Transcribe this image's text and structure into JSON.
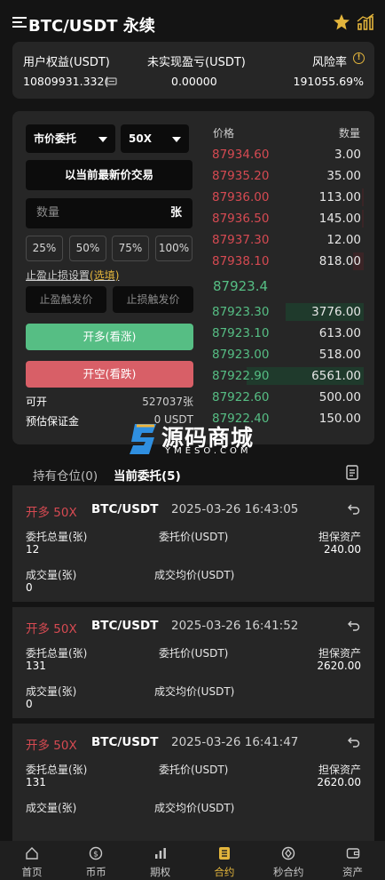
{
  "header": {
    "title": "BTC/USDT 永续"
  },
  "summary": {
    "equity_label": "用户权益(USDT)",
    "equity_value": "10809931.332(",
    "pnl_label": "未实现盈亏(USDT)",
    "pnl_value": "0.00000",
    "risk_label": "风险率",
    "risk_value": "191055.69%"
  },
  "trade": {
    "order_type": "市价委托",
    "leverage": "50X",
    "latest_price_button": "以当前最新价交易",
    "quantity_placeholder": "数量",
    "quantity_unit": "张",
    "percents": [
      "25%",
      "50%",
      "75%",
      "100%"
    ],
    "tpsl_label": "止盈止损设置",
    "tpsl_optional": "(选填)",
    "tp_placeholder": "止盈触发价",
    "sl_placeholder": "止损触发价",
    "long_button": "开多(看涨)",
    "short_button": "开空(看跌)",
    "available_label": "可开",
    "available_value": "527037张",
    "margin_label": "预估保证金",
    "margin_value": "0 USDT"
  },
  "orderbook": {
    "price_header": "价格",
    "qty_header": "数量",
    "asks": [
      {
        "price": "87934.60",
        "qty": "3.00",
        "depth": 0.0
      },
      {
        "price": "87935.20",
        "qty": "35.00",
        "depth": 0.0
      },
      {
        "price": "87936.00",
        "qty": "113.00",
        "depth": 0.01
      },
      {
        "price": "87936.50",
        "qty": "145.00",
        "depth": 0.01
      },
      {
        "price": "87937.30",
        "qty": "12.00",
        "depth": 0.0
      },
      {
        "price": "87938.10",
        "qty": "818.00",
        "depth": 0.07
      }
    ],
    "mid_price": "87923.4",
    "bids": [
      {
        "price": "87923.30",
        "qty": "3776.00",
        "depth": 0.5
      },
      {
        "price": "87923.10",
        "qty": "613.00",
        "depth": 0.0
      },
      {
        "price": "87923.00",
        "qty": "518.00",
        "depth": 0.0
      },
      {
        "price": "87922.90",
        "qty": "6561.00",
        "depth": 0.75
      },
      {
        "price": "87922.60",
        "qty": "500.00",
        "depth": 0.0
      },
      {
        "price": "87922.40",
        "qty": "150.00",
        "depth": 0.0
      }
    ]
  },
  "watermark": {
    "cn": "源码商城",
    "en": "YMESO.COM"
  },
  "tabs": {
    "positions": "持有仓位(0)",
    "orders": "当前委托(5)"
  },
  "orders": [
    {
      "side": "开多 50X",
      "symbol": "BTC/USDT",
      "time": "2025-03-26 16:43:05",
      "total_label": "委托总量(张)",
      "total": "12",
      "price_label": "委托价(USDT)",
      "price": "",
      "margin_label": "担保资产",
      "margin": "240.00",
      "filled_label": "成交量(张)",
      "filled": "0",
      "avg_label": "成交均价(USDT)",
      "avg": ""
    },
    {
      "side": "开多 50X",
      "symbol": "BTC/USDT",
      "time": "2025-03-26 16:41:52",
      "total_label": "委托总量(张)",
      "total": "131",
      "price_label": "委托价(USDT)",
      "price": "",
      "margin_label": "担保资产",
      "margin": "2620.00",
      "filled_label": "成交量(张)",
      "filled": "0",
      "avg_label": "成交均价(USDT)",
      "avg": ""
    },
    {
      "side": "开多 50X",
      "symbol": "BTC/USDT",
      "time": "2025-03-26 16:41:47",
      "total_label": "委托总量(张)",
      "total": "131",
      "price_label": "委托价(USDT)",
      "price": "",
      "margin_label": "担保资产",
      "margin": "2620.00",
      "filled_label": "成交量(张)",
      "filled": "",
      "avg_label": "成交均价(USDT)",
      "avg": ""
    }
  ],
  "nav": [
    {
      "label": "首页",
      "icon": "home-icon",
      "active": false
    },
    {
      "label": "币币",
      "icon": "coin-icon",
      "active": false
    },
    {
      "label": "期权",
      "icon": "options-bars-icon",
      "active": false
    },
    {
      "label": "合约",
      "icon": "contract-icon",
      "active": true
    },
    {
      "label": "秒合约",
      "icon": "second-contract-icon",
      "active": false
    },
    {
      "label": "资产",
      "icon": "wallet-icon",
      "active": false
    }
  ],
  "colors": {
    "accent": "#e3b53c",
    "up": "#56be84",
    "down": "#d64a52",
    "panel": "#262626",
    "bg": "#141414"
  }
}
